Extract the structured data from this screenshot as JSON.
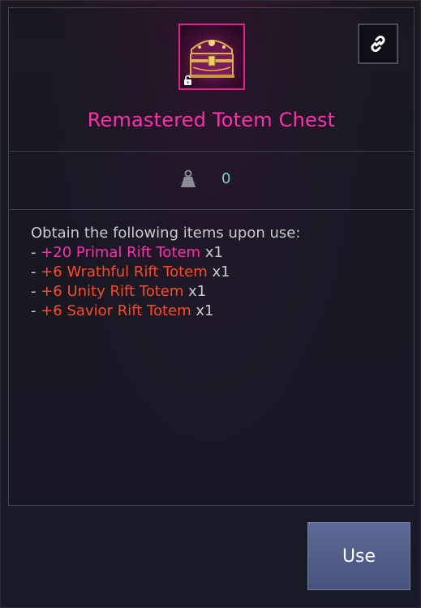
{
  "item": {
    "title": "Remastered Totem Chest",
    "icon": "treasure-chest",
    "title_color": "#ff2fae"
  },
  "stat": {
    "icon": "weight-icon",
    "value": "0"
  },
  "description": {
    "intro": "Obtain the following items upon use:",
    "rewards": [
      {
        "prefix": "- ",
        "name": "+20 Primal Rift Totem",
        "qty": "x1",
        "color": "#ff2fae"
      },
      {
        "prefix": "- ",
        "name": "+6 Wrathful Rift Totem",
        "qty": "x1",
        "color": "#ff4a24"
      },
      {
        "prefix": "- ",
        "name": "+6 Unity Rift Totem",
        "qty": "x1",
        "color": "#ff4a24"
      },
      {
        "prefix": "- ",
        "name": "+6 Savior Rift Totem",
        "qty": "x1",
        "color": "#ff4a24"
      }
    ]
  },
  "actions": {
    "use_label": "Use",
    "link_icon": "link-icon"
  }
}
